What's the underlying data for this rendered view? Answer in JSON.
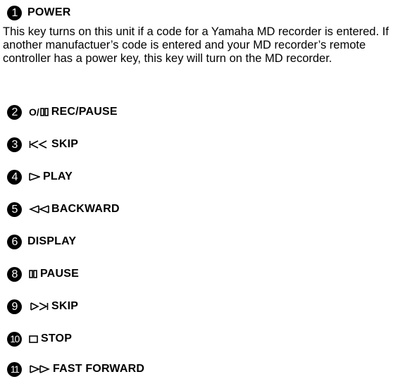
{
  "items": [
    {
      "number": "1",
      "label": "POWER",
      "icon": "none"
    },
    {
      "number": "2",
      "label": "REC/PAUSE",
      "icon": "rec-pause-icon"
    },
    {
      "number": "3",
      "label": "SKIP",
      "icon": "skip-back-icon"
    },
    {
      "number": "4",
      "label": "PLAY",
      "icon": "play-icon"
    },
    {
      "number": "5",
      "label": "BACKWARD",
      "icon": "rewind-icon"
    },
    {
      "number": "6",
      "label": "DISPLAY",
      "icon": "none"
    },
    {
      "number": "8",
      "label": "PAUSE",
      "icon": "pause-icon"
    },
    {
      "number": "9",
      "label": "SKIP",
      "icon": "skip-forward-icon"
    },
    {
      "number": "10",
      "label": "STOP",
      "icon": "stop-icon"
    },
    {
      "number": "11",
      "label": "FAST FORWARD",
      "icon": "fast-forward-icon"
    }
  ],
  "power_description": "This key turns on this unit if a code for a Yamaha MD recorder is entered. If another manufactuer’s code is entered and your MD recorder’s remote controller has a power key, this key will turn on the MD recorder.",
  "rec_pause_symbol_text": "O/"
}
